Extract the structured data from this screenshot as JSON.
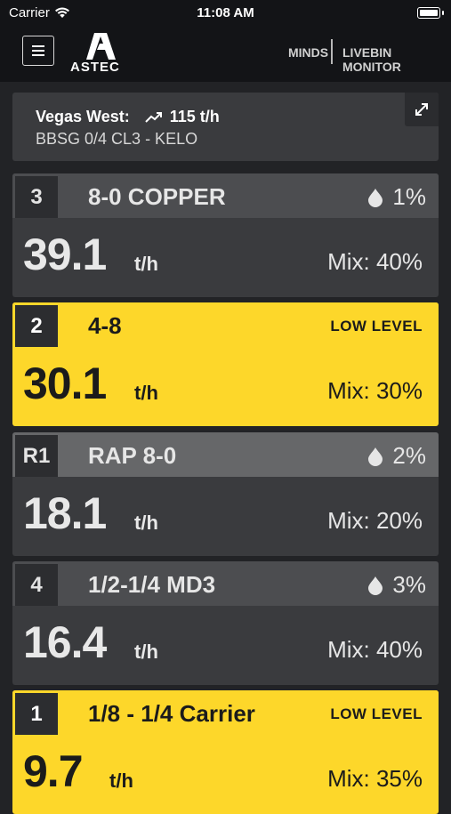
{
  "status_bar": {
    "carrier": "Carrier",
    "time": "11:08 AM"
  },
  "header": {
    "logo_text": "ASTEC",
    "nav_minds": "MINDS",
    "nav_monitor": "LIVEBIN MONITOR"
  },
  "summary": {
    "plant": "Vegas West:",
    "total_rate": "115 t/h",
    "mix_name": "BBSG 0/4 CL3 - KELO"
  },
  "bins": [
    {
      "badge": "3",
      "name": "8-0 COPPER",
      "moisture": "1%",
      "rate": "39.1",
      "unit": "t/h",
      "mix": "Mix: 40%"
    },
    {
      "badge": "2",
      "name": "4-8",
      "status": "LOW LEVEL",
      "rate": "30.1",
      "unit": "t/h",
      "mix": "Mix: 30%"
    },
    {
      "badge": "R1",
      "name": "RAP 8-0",
      "moisture": "2%",
      "rate": "18.1",
      "unit": "t/h",
      "mix": "Mix: 20%"
    },
    {
      "badge": "4",
      "name": "1/2-1/4 MD3",
      "moisture": "3%",
      "rate": "16.4",
      "unit": "t/h",
      "mix": "Mix: 40%"
    },
    {
      "badge": "1",
      "name": "1/8 - 1/4 Carrier",
      "status": "LOW LEVEL",
      "rate": "9.7",
      "unit": "t/h",
      "mix": "Mix: 35%"
    }
  ],
  "colors": {
    "background": "#222326",
    "card": "#3a3b3e",
    "warning": "#fdd72a"
  }
}
